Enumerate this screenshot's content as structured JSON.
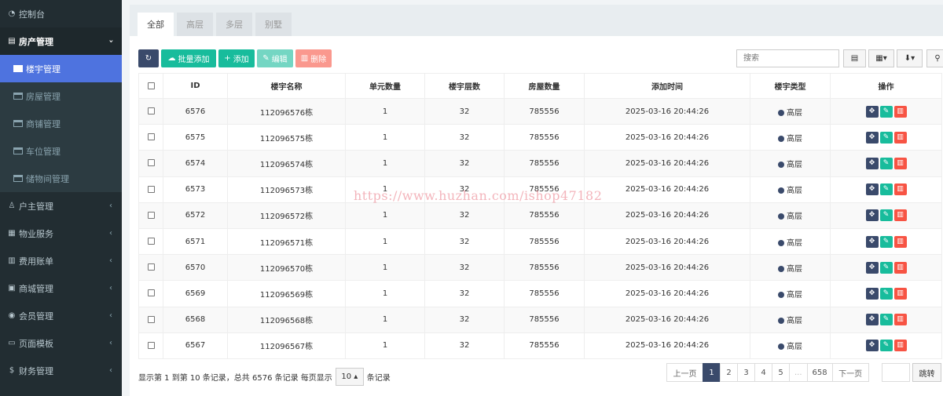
{
  "sidebar": {
    "console": "控制台",
    "property_group": "房产管理",
    "sub_items": [
      "楼宇管理",
      "房屋管理",
      "商铺管理",
      "车位管理",
      "储物间管理"
    ],
    "groups": [
      "户主管理",
      "物业服务",
      "费用账单",
      "商城管理",
      "会员管理",
      "页面模板",
      "财务管理"
    ],
    "active_sub": "楼宇管理",
    "active_color": "#4e73df"
  },
  "tabs": [
    "全部",
    "高层",
    "多层",
    "别墅"
  ],
  "toolbar": {
    "batch_add": "批量添加",
    "add": "添加",
    "edit": "编辑",
    "delete": "删除",
    "search_placeholder": "搜索"
  },
  "table": {
    "headers": [
      "ID",
      "楼宇名称",
      "单元数量",
      "楼宇层数",
      "房屋数量",
      "添加时间",
      "楼宇类型",
      "操作"
    ],
    "rows": [
      {
        "id": "6576",
        "name": "112096576栋",
        "units": "1",
        "floors": "32",
        "houses": "785556",
        "time": "2025-03-16 20:44:26",
        "type": "高层"
      },
      {
        "id": "6575",
        "name": "112096575栋",
        "units": "1",
        "floors": "32",
        "houses": "785556",
        "time": "2025-03-16 20:44:26",
        "type": "高层"
      },
      {
        "id": "6574",
        "name": "112096574栋",
        "units": "1",
        "floors": "32",
        "houses": "785556",
        "time": "2025-03-16 20:44:26",
        "type": "高层"
      },
      {
        "id": "6573",
        "name": "112096573栋",
        "units": "1",
        "floors": "32",
        "houses": "785556",
        "time": "2025-03-16 20:44:26",
        "type": "高层"
      },
      {
        "id": "6572",
        "name": "112096572栋",
        "units": "1",
        "floors": "32",
        "houses": "785556",
        "time": "2025-03-16 20:44:26",
        "type": "高层"
      },
      {
        "id": "6571",
        "name": "112096571栋",
        "units": "1",
        "floors": "32",
        "houses": "785556",
        "time": "2025-03-16 20:44:26",
        "type": "高层"
      },
      {
        "id": "6570",
        "name": "112096570栋",
        "units": "1",
        "floors": "32",
        "houses": "785556",
        "time": "2025-03-16 20:44:26",
        "type": "高层"
      },
      {
        "id": "6569",
        "name": "112096569栋",
        "units": "1",
        "floors": "32",
        "houses": "785556",
        "time": "2025-03-16 20:44:26",
        "type": "高层"
      },
      {
        "id": "6568",
        "name": "112096568栋",
        "units": "1",
        "floors": "32",
        "houses": "785556",
        "time": "2025-03-16 20:44:26",
        "type": "高层"
      },
      {
        "id": "6567",
        "name": "112096567栋",
        "units": "1",
        "floors": "32",
        "houses": "785556",
        "time": "2025-03-16 20:44:26",
        "type": "高层"
      }
    ]
  },
  "footer": {
    "summary_before": "显示第 1 到第 10 条记录，总共 6576 条记录 每页显示",
    "page_size": "10",
    "summary_after": "条记录",
    "prev": "上一页",
    "next": "下一页",
    "pages": [
      "1",
      "2",
      "3",
      "4",
      "5",
      "...",
      "658"
    ],
    "current_page": "1",
    "jump": "跳转"
  },
  "watermark": "https://www.huzhan.com/ishop47182"
}
